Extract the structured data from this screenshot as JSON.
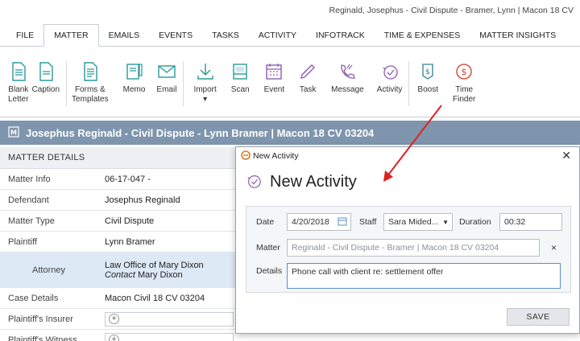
{
  "window": {
    "title": "Reginald, Josephus - Civil Dispute - Bramer, Lynn | Macon 18 CV"
  },
  "menubar": {
    "tabs": [
      "FILE",
      "MATTER",
      "EMAILS",
      "EVENTS",
      "TASKS",
      "ACTIVITY",
      "INFOTRACK",
      "TIME & EXPENSES",
      "MATTER INSIGHTS"
    ],
    "active": "MATTER"
  },
  "ribbon": {
    "buttons": [
      {
        "label": "Blank\nLetter",
        "icon": "document-icon"
      },
      {
        "label": "Caption",
        "icon": "document-icon"
      },
      {
        "label": "Forms &\nTemplates",
        "icon": "document-icon"
      },
      {
        "label": "Memo",
        "icon": "memo-icon"
      },
      {
        "label": "Email",
        "icon": "envelope-icon"
      },
      {
        "label": "Import\n▾",
        "icon": "download-icon"
      },
      {
        "label": "Scan",
        "icon": "scanner-icon"
      },
      {
        "label": "Event",
        "icon": "calendar-icon"
      },
      {
        "label": "Task",
        "icon": "pencil-icon"
      },
      {
        "label": "Message",
        "icon": "phone-icon"
      },
      {
        "label": "Activity",
        "icon": "activity-icon"
      },
      {
        "label": "Boost",
        "icon": "boost-icon"
      },
      {
        "label": "Time\nFinder",
        "icon": "dollar-icon"
      }
    ]
  },
  "matter_bar": {
    "title": "Josephus Reginald - Civil Dispute - Lynn Bramer | Macon 18 CV 03204"
  },
  "matter_details": {
    "header": "MATTER DETAILS",
    "rows": [
      {
        "key": "Matter Info",
        "value": "06-17-047 -"
      },
      {
        "key": "Defendant",
        "value": "Josephus Reginald"
      },
      {
        "key": "Matter Type",
        "value": "Civil Dispute"
      },
      {
        "key": "Plaintiff",
        "value": "Lynn Bramer"
      },
      {
        "key": "Attorney",
        "value": "Law Office of Mary Dixon",
        "contact_label": "Contact",
        "contact_name": "Mary Dixon"
      },
      {
        "key": "Case Details",
        "value": "Macon Civil 18 CV 03204"
      },
      {
        "key": "Plaintiff's Insurer",
        "value": ""
      },
      {
        "key": "Plaintiff's Witness",
        "value": ""
      }
    ]
  },
  "dialog": {
    "window_title": "New Activity",
    "heading": "New Activity",
    "date_label": "Date",
    "date_value": "4/20/2018",
    "staff_label": "Staff",
    "staff_value": "Sara Mided...",
    "duration_label": "Duration",
    "duration_value": "00:32",
    "matter_label": "Matter",
    "matter_value": "Reginald - Civil Dispute - Bramer | Macon 18 CV 03204",
    "details_label": "Details",
    "details_value": "Phone call with client re: settlement offer",
    "save_label": "SAVE"
  },
  "colors": {
    "matter_bar": "#7f95ae",
    "accent_teal": "#2a9a9a",
    "accent_purple": "#8d5cb0",
    "accent_red": "#d23b2b",
    "arrow": "#e02020"
  }
}
